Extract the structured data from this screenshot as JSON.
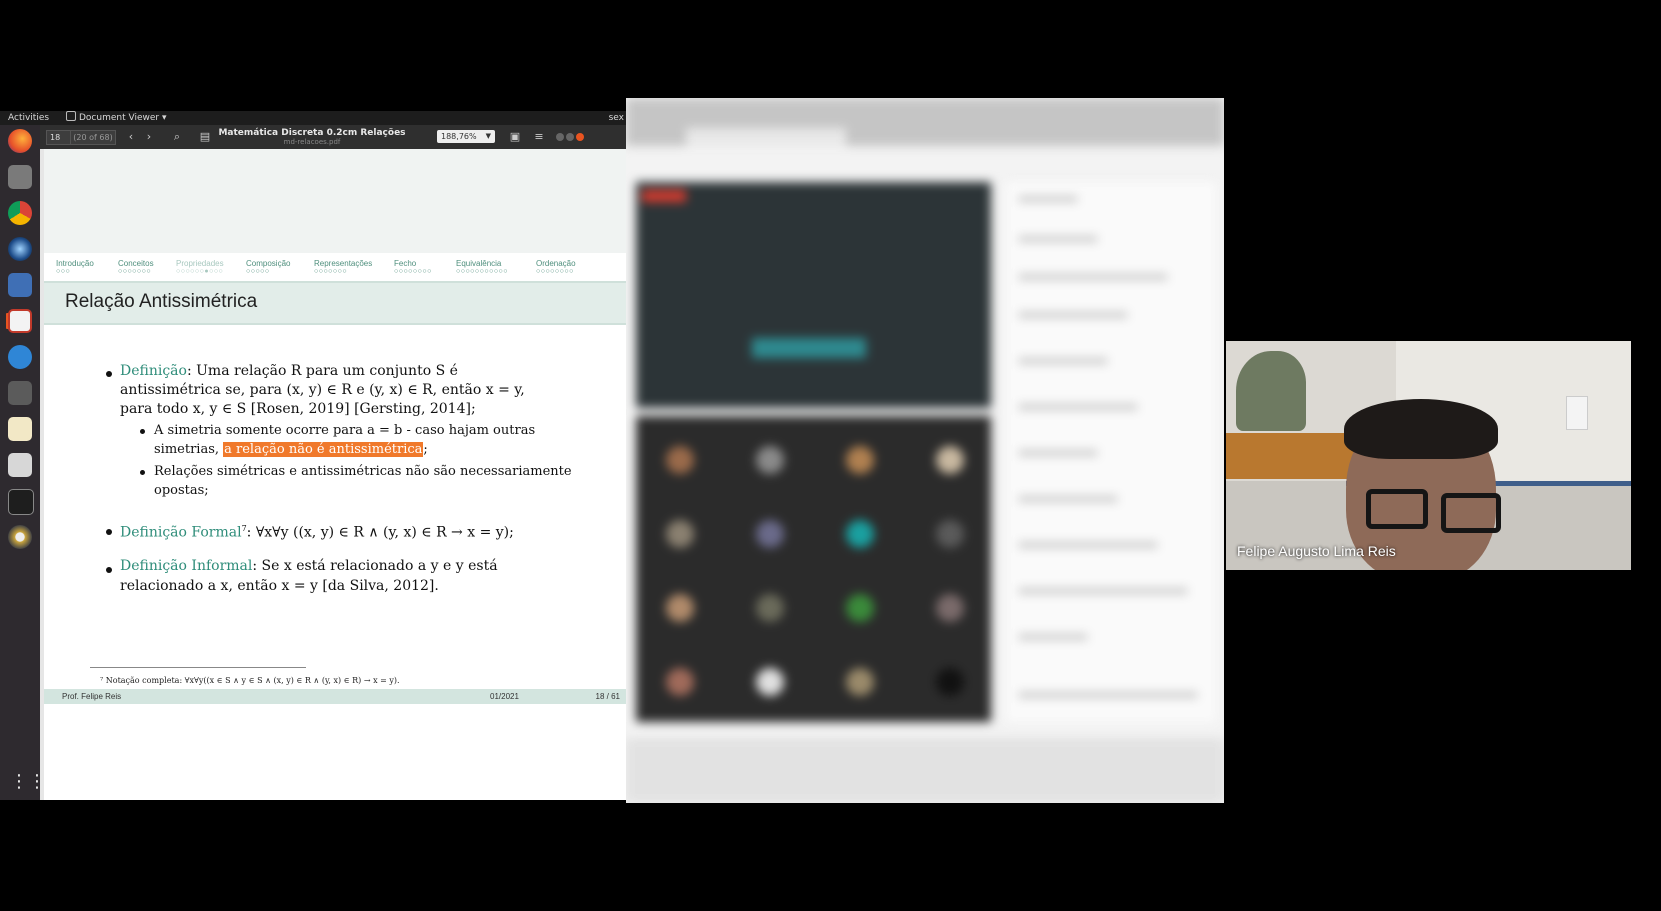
{
  "topbar": {
    "activities": "Activities",
    "app_menu": "Document Viewer ▾",
    "clock": "sex"
  },
  "toolbar": {
    "page_number": "18",
    "page_of": "(20 of 68)",
    "title": "Matemática Discreta   0.2cm Relações",
    "subtitle": "md-relacoes.pdf",
    "zoom": "188,76%"
  },
  "slide": {
    "nav": [
      {
        "label": "Introdução",
        "dots": "○○○"
      },
      {
        "label": "Conceitos",
        "dots": "○○○○○○○"
      },
      {
        "label": "Propriedades",
        "dots": "○○○○○○●○○○"
      },
      {
        "label": "Composição",
        "dots": "○○○○○"
      },
      {
        "label": "Representações",
        "dots": "○○○○○○○"
      },
      {
        "label": "Fecho",
        "dots": "○○○○○○○○"
      },
      {
        "label": "Equivalência",
        "dots": "○○○○○○○○○○○"
      },
      {
        "label": "Ordenação",
        "dots": "○○○○○○○○"
      }
    ],
    "frame_title": "Relação Antissimétrica",
    "def_term": "Definição",
    "def_line1": ": Uma relação R para um conjunto S é",
    "def_line2": "antissimétrica se, para (x, y) ∈ R e (y, x) ∈ R, então x = y,",
    "def_line3": "para todo x, y ∈ S [Rosen, 2019] [Gersting, 2014];",
    "sub1_line1": "A simetria somente ocorre para a = b - caso hajam outras",
    "sub1_line2a": "simetrias, ",
    "sub1_highlight": "a relação não é antissimétrica",
    "sub1_line2b": ";",
    "sub2_line1": "Relações simétricas e antissimétricas não são necessariamente",
    "sub2_line2": "opostas;",
    "formal_term": "Definição Formal",
    "formal_sup": "7",
    "formal_text": ": ∀x∀y ((x, y) ∈ R ∧ (y, x) ∈ R → x = y);",
    "informal_term": "Definição Informal",
    "informal_line1": ": Se x está relacionado a y e y está",
    "informal_line2": "relacionado a x, então x = y [da Silva, 2012].",
    "footnote": "⁷ Notação completa: ∀x∀y((x ∈ S ∧ y ∈ S ∧ (x, y) ∈ R ∧ (y, x) ∈ R) → x = y).",
    "footer_author": "Prof. Felipe Reis",
    "footer_date": "01/2021",
    "footer_page": "18 / 61"
  },
  "webcam": {
    "name": "Felipe Augusto Lima Reis"
  },
  "colors": {
    "accent": "#2f8d7a",
    "highlight": "#f0792b",
    "ubuntu": "#e95420"
  },
  "icons": [
    "firefox-icon",
    "files-icon",
    "chrome-icon",
    "app-icon",
    "word-icon",
    "eclipse-icon",
    "kde-icon",
    "tool-icon",
    "editor-icon",
    "calculator-icon",
    "terminal-icon",
    "disk-icon",
    "apps-grid-icon"
  ]
}
